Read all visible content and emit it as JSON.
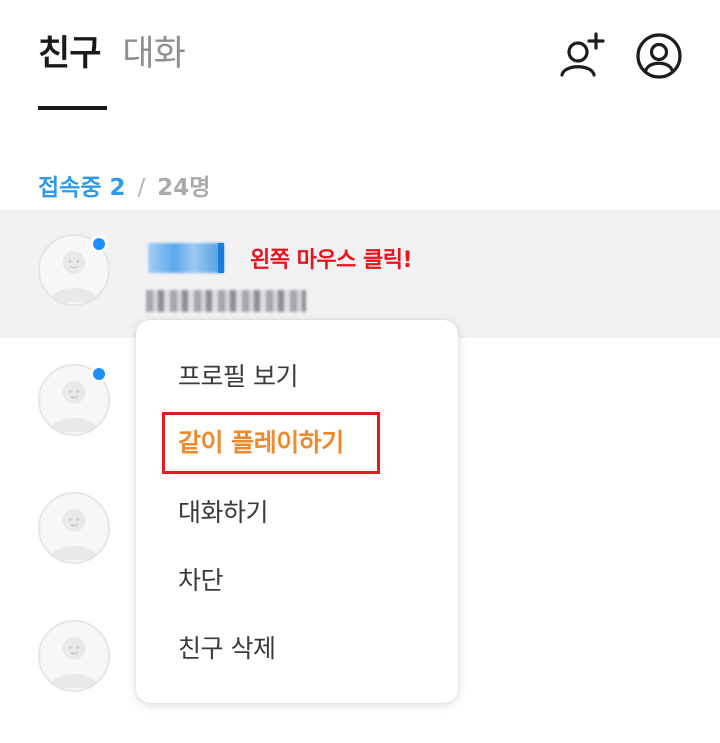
{
  "header": {
    "tabs": [
      {
        "label": "친구",
        "active": true
      },
      {
        "label": "대화",
        "active": false
      }
    ],
    "icons": [
      "add-friend-icon",
      "profile-icon"
    ]
  },
  "online": {
    "label": "접속중",
    "count": "2",
    "separator": "/",
    "total": "24명"
  },
  "friends": [
    {
      "online": true,
      "name": "(blurred)",
      "status": "(blurred)"
    },
    {
      "online": true
    },
    {
      "online": false
    },
    {
      "online": false
    }
  ],
  "annotation": "왼쪽 마우스 클릭!",
  "context_menu": {
    "items": [
      {
        "label": "프로필 보기"
      },
      {
        "label": "같이 플레이하기",
        "highlighted": true
      },
      {
        "label": "대화하기"
      },
      {
        "label": "차단"
      },
      {
        "label": "친구 삭제"
      }
    ]
  },
  "colors": {
    "accent_blue": "#2f9be8",
    "online_dot": "#1e90ff",
    "highlight_orange": "#ef8a2c",
    "annotation_red": "#e8141b"
  }
}
